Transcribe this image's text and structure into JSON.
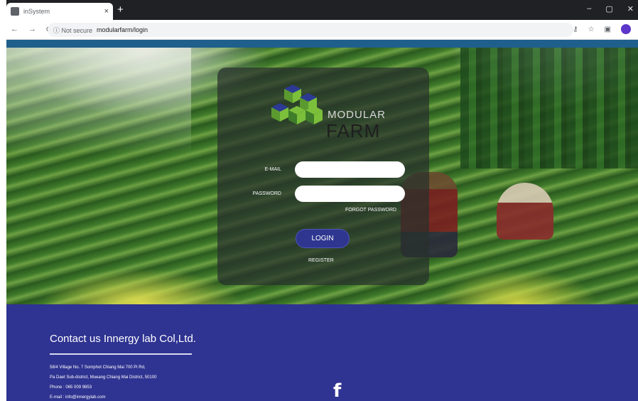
{
  "browser": {
    "tab_title": "inSystem",
    "tab_close": "×",
    "new_tab": "+",
    "back": "←",
    "forward": "→",
    "reload": "⟳",
    "url_security": "ⓘ Not secure",
    "url_path": "modularfarm/login",
    "minimize": "–",
    "maximize": "▢",
    "close": "✕"
  },
  "logo": {
    "line1": "MODULAR",
    "line2": "FARM",
    "colors": {
      "blue": "#2c3a94",
      "green": "#7cbf3a",
      "dark_green": "#3f7d2a"
    }
  },
  "form": {
    "email_label": "E-MAIL",
    "email_value": "",
    "password_label": "PASSWORD",
    "password_value": "",
    "forgot_label": "FORGOT PASSWORD",
    "login_label": "LOGIN",
    "register_label": "REGISTER"
  },
  "footer": {
    "title": "Contact us Innergy lab Col,Ltd.",
    "address_1": "58/4 Village No. 7 Somphot Chiang Mai 700 Pi Rd,",
    "address_2": "Pa Daet Sub-district, Mueang Chiang Mai District, 50100",
    "phone": "Phone : 065 009 9853",
    "email": "E-mail : info@innergylab.com",
    "social_icon": "f"
  },
  "colors": {
    "footer_bg": "#2f3391",
    "top_strip": "#1f5f8b",
    "button_bg": "#2e3690"
  }
}
